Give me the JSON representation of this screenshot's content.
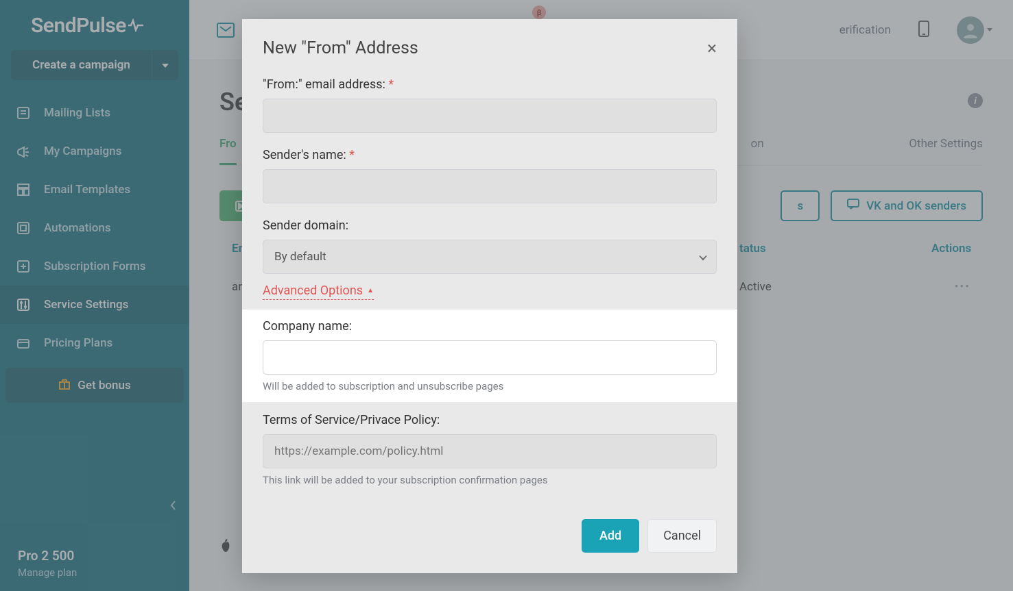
{
  "logo": "SendPulse",
  "create_button": "Create a campaign",
  "sidebar": {
    "items": [
      {
        "label": "Mailing Lists"
      },
      {
        "label": "My Campaigns"
      },
      {
        "label": "Email Templates"
      },
      {
        "label": "Automations"
      },
      {
        "label": "Subscription Forms"
      },
      {
        "label": "Service Settings"
      },
      {
        "label": "Pricing Plans"
      }
    ],
    "bonus": "Get bonus",
    "plan": "Pro 2 500",
    "manage": "Manage plan"
  },
  "header": {
    "verification": "erification",
    "beta": "β"
  },
  "page": {
    "title": "Se",
    "tabs": [
      "Fro",
      "on",
      "Other Settings"
    ],
    "buttons": {
      "vk": "VK and OK senders",
      "s": "s"
    },
    "table": {
      "headers": [
        "Em",
        "tatus",
        "Actions"
      ],
      "row": {
        "email": "an",
        "status": "Active",
        "actions": "•••"
      }
    }
  },
  "modal": {
    "title": "New \"From\" Address",
    "from_label": "\"From:\" email address:",
    "sender_name_label": "Sender's name:",
    "sender_domain_label": "Sender domain:",
    "sender_domain_value": "By default",
    "advanced": "Advanced Options",
    "company_label": "Company name:",
    "company_help": "Will be added to subscription and unsubscribe pages",
    "tos_label": "Terms of Service/Privace Policy:",
    "tos_placeholder": "https://example.com/policy.html",
    "tos_help": "This link will be added to your subscription confirmation pages",
    "add": "Add",
    "cancel": "Cancel"
  }
}
